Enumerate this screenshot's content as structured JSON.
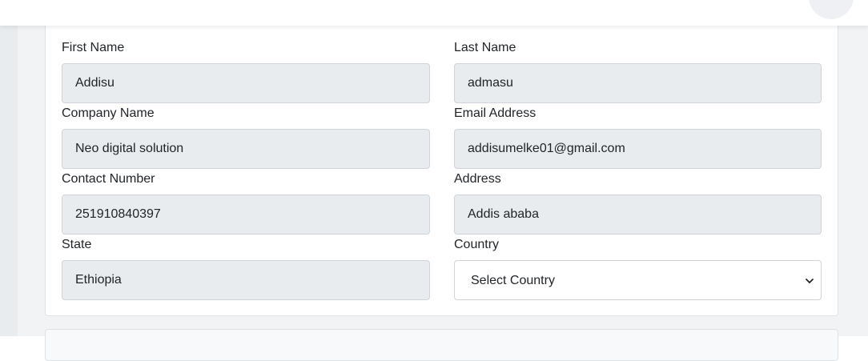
{
  "header": {
    "icons": [
      "gear-icon",
      "bell-icon",
      "avatar"
    ]
  },
  "form": {
    "first_name": {
      "label": "First Name",
      "value": "Addisu"
    },
    "last_name": {
      "label": "Last Name",
      "value": "admasu"
    },
    "company_name": {
      "label": "Company Name",
      "value": "Neo digital solution"
    },
    "email": {
      "label": "Email Address",
      "value": "addisumelke01@gmail.com"
    },
    "contact_number": {
      "label": "Contact Number",
      "value": "251910840397"
    },
    "address": {
      "label": "Address",
      "value": "Addis ababa"
    },
    "state": {
      "label": "State",
      "value": "Ethiopia"
    },
    "country": {
      "label": "Country",
      "selected": "Select Country"
    }
  },
  "colors": {
    "input_bg": "#e9ecef",
    "border": "#ced4da",
    "page_bg": "#f1f3f5"
  }
}
